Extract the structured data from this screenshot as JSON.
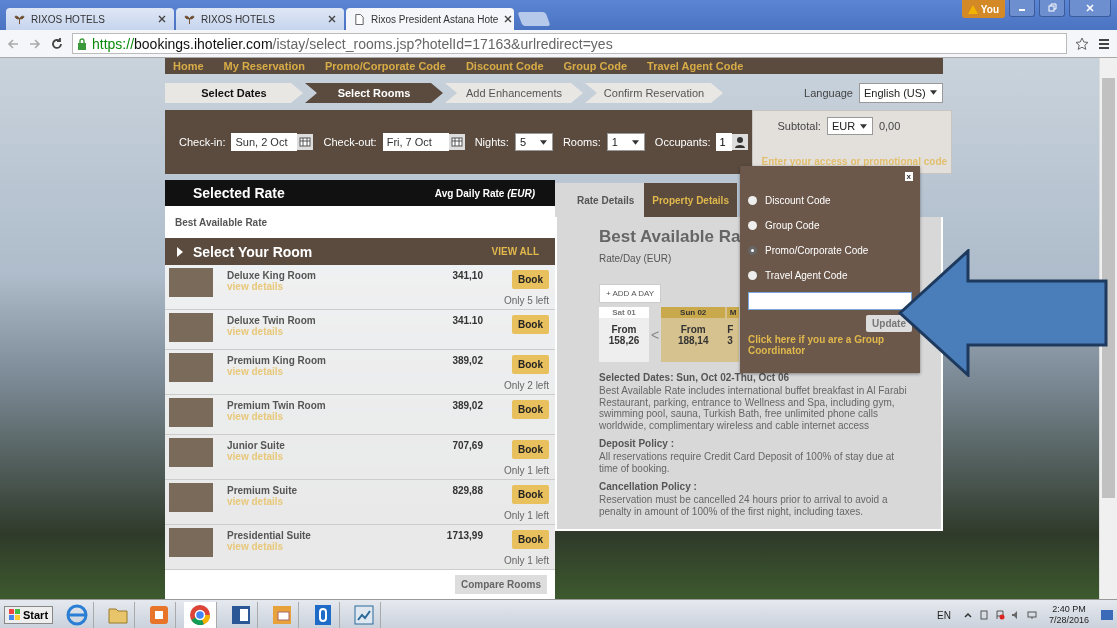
{
  "browser": {
    "tabs": [
      {
        "title": "RIXOS HOTELS",
        "selected": false
      },
      {
        "title": "RIXOS HOTELS",
        "selected": false
      },
      {
        "title": "Rixos President Astana Hote",
        "selected": true
      }
    ],
    "user": "You",
    "url": {
      "scheme": "https://",
      "host": "bookings.ihotelier.com",
      "path": "/istay/select_rooms.jsp?hotelId=17163&urlredirect=yes"
    }
  },
  "site_nav": [
    "Home",
    "My Reservation",
    "Promo/Corporate Code",
    "Discount Code",
    "Group Code",
    "Travel Agent Code"
  ],
  "steps": [
    {
      "label": "Select Dates",
      "selected": false
    },
    {
      "label": "Select Rooms",
      "selected": true
    },
    {
      "label": "Add Enhancements",
      "selected": false
    },
    {
      "label": "Confirm Reservation",
      "selected": false
    }
  ],
  "language": {
    "label": "Language",
    "value": "English (US)"
  },
  "search": {
    "checkin_label": "Check-in:",
    "checkin": "Sun, 2 Oct",
    "checkout_label": "Check-out:",
    "checkout": "Fri, 7 Oct",
    "nights_label": "Nights:",
    "nights": "5",
    "rooms_label": "Rooms:",
    "rooms": "1",
    "occupants_label": "Occupants:",
    "occupants": "1"
  },
  "subtotal": {
    "label": "Subtotal:",
    "currency": "EUR",
    "amount": "0,00",
    "promo_link": "Enter your access or promotional code"
  },
  "selected_rate": {
    "title": "Selected Rate",
    "avg_label": "Avg Daily Rate *(EUR)*",
    "rate_name": "Best Available Rate"
  },
  "room_list": {
    "title": "Select Your Room",
    "view_all": "VIEW ALL",
    "compare": "Compare Rooms",
    "rooms": [
      {
        "name": "Deluxe King Room",
        "details": "view details",
        "price": "341,10",
        "book": "Book",
        "availability": "Only 5 left"
      },
      {
        "name": "Deluxe Twin Room",
        "details": "view details",
        "price": "341.10",
        "book": "Book"
      },
      {
        "name": "Premium King Room",
        "details": "view details",
        "price": "389,02",
        "book": "Book",
        "availability": "Only 2 left"
      },
      {
        "name": "Premium Twin Room",
        "details": "view details",
        "price": "389,02",
        "book": "Book"
      },
      {
        "name": "Junior Suite",
        "details": "view details",
        "price": "707,69",
        "book": "Book",
        "availability": "Only 1 left"
      },
      {
        "name": "Premium Suite",
        "details": "view details",
        "price": "829,88",
        "book": "Book",
        "availability": "Only 1 left"
      },
      {
        "name": "Presidential Suite",
        "details": "view details",
        "price": "1713,99",
        "book": "Book",
        "availability": "Only 1 left"
      }
    ]
  },
  "details": {
    "tabs": [
      {
        "label": "Rate Details",
        "selected": true
      },
      {
        "label": "Property Details",
        "selected": false
      }
    ],
    "heading": "Best Available Ra",
    "subheading": "Rate/Day (EUR)",
    "add_day": "+ ADD A DAY",
    "prev": "<",
    "days": [
      {
        "label": "Sat 01",
        "from": "From",
        "price": "158,26",
        "selected": false
      },
      {
        "label": "Sun 02",
        "from": "From",
        "price": "188,14",
        "selected": true
      },
      {
        "label": "M",
        "from": "F",
        "price": "3",
        "selected": true
      }
    ],
    "selected_dates": "Selected Dates: Sun, Oct 02-Thu, Oct 06",
    "description": "Best Available Rate includes international buffet breakfast in Al Farabi Restaurant, parking, entrance to Wellness and Spa, including gym, swimming pool, sauna, Turkish Bath, free unlimited phone calls worldwide, complimentary wireless and cable internet access",
    "policies": [
      {
        "title": "Deposit Policy :",
        "text": "All reservations require Credit Card Deposit of 100% of stay due at time of booking."
      },
      {
        "title": "Cancellation Policy :",
        "text": "Reservation must be cancelled 24 hours prior to arrival to avoid a penalty in amount of 100% of the first night, including taxes."
      }
    ]
  },
  "code_popup": {
    "close": "x",
    "options": [
      {
        "label": "Discount Code",
        "selected": false
      },
      {
        "label": "Group Code",
        "selected": false
      },
      {
        "label": "Promo/Corporate Code",
        "selected": true
      },
      {
        "label": "Travel Agent Code",
        "selected": false
      }
    ],
    "update": "Update",
    "group_link": "Click here if you are a Group Coordinator"
  },
  "taskbar": {
    "start": "Start",
    "language": "EN",
    "time": "2:40 PM",
    "date": "7/28/2016"
  }
}
